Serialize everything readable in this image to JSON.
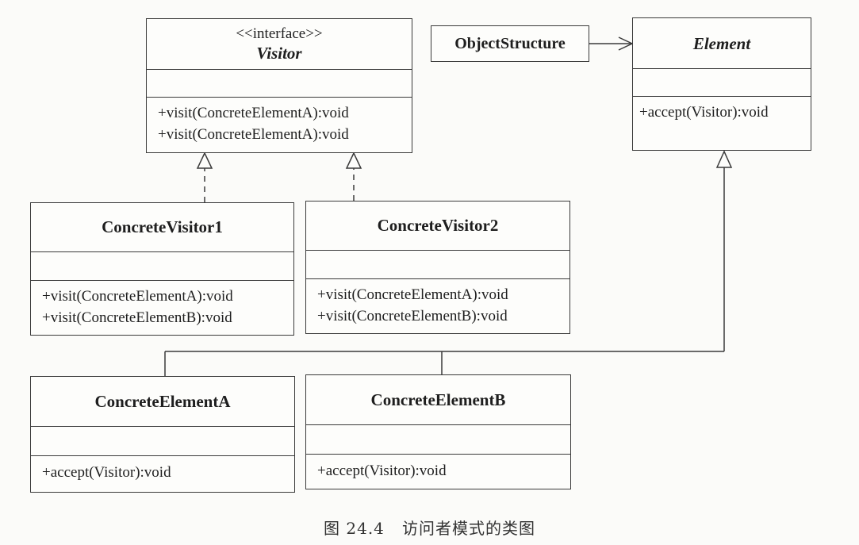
{
  "visitor": {
    "stereotype": "<<interface>>",
    "name": "Visitor",
    "operations": [
      "+visit(ConcreteElementA):void",
      "+visit(ConcreteElementA):void"
    ]
  },
  "object_structure": {
    "name": "ObjectStructure"
  },
  "element": {
    "name": "Element",
    "operations": [
      "+accept(Visitor):void"
    ]
  },
  "concrete_visitor_1": {
    "name": "ConcreteVisitor1",
    "operations": [
      "+visit(ConcreteElementA):void",
      "+visit(ConcreteElementB):void"
    ]
  },
  "concrete_visitor_2": {
    "name": "ConcreteVisitor2",
    "operations": [
      "+visit(ConcreteElementA):void",
      "+visit(ConcreteElementB):void"
    ]
  },
  "concrete_element_a": {
    "name": "ConcreteElementA",
    "operations": [
      "+accept(Visitor):void"
    ]
  },
  "concrete_element_b": {
    "name": "ConcreteElementB",
    "operations": [
      "+accept(Visitor):void"
    ]
  },
  "caption": "图 24.4   访问者模式的类图"
}
